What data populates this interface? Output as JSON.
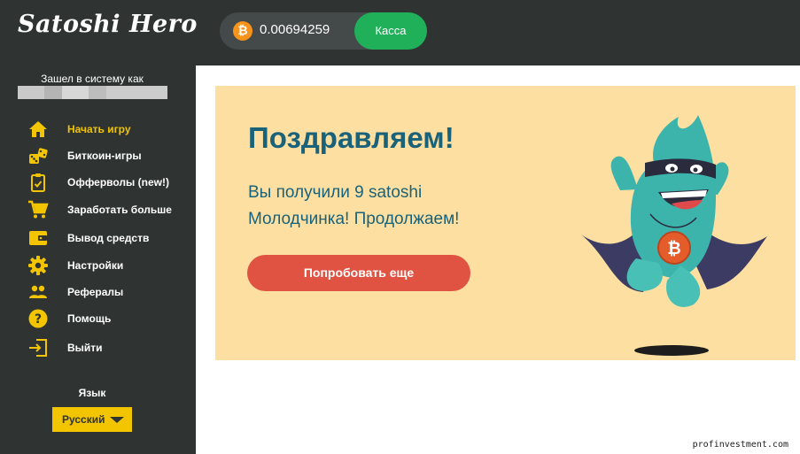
{
  "header": {
    "logo_text": "Satoshi Hero",
    "currency_icon": "bitcoin-icon",
    "currency_symbol": "₿",
    "balance": "0.00694259",
    "cashier_label": "Касса"
  },
  "sidebar": {
    "logged_in_label": "Зашел в систему как",
    "items": [
      {
        "label": "Начать игру",
        "icon": "home-icon",
        "active": true
      },
      {
        "label": "Биткоин-игры",
        "icon": "dice-icon",
        "active": false
      },
      {
        "label": "Офферволы (new!)",
        "icon": "clipboard-icon",
        "active": false
      },
      {
        "label": "Заработать больше",
        "icon": "cart-icon",
        "active": false
      },
      {
        "label": "Вывод средств",
        "icon": "wallet-icon",
        "active": false
      },
      {
        "label": "Настройки",
        "icon": "gear-icon",
        "active": false
      },
      {
        "label": "Рефералы",
        "icon": "people-icon",
        "active": false
      },
      {
        "label": "Помощь",
        "icon": "help-icon",
        "active": false
      },
      {
        "label": "Выйти",
        "icon": "logout-icon",
        "active": false
      }
    ],
    "language_title": "Язык",
    "language_selected": "Русский"
  },
  "banner": {
    "title": "Поздравляем!",
    "line1": "Вы получили 9 satoshi",
    "line2": "Молодчинка! Продолжаем!",
    "retry_label": "Попробовать еще",
    "mascot_coin_symbol": "₿"
  },
  "watermark": "profinvestment.com",
  "colors": {
    "dark": "#2f3432",
    "accent_yellow": "#f2c500",
    "green": "#21b05a",
    "banner_bg": "#fde0a1",
    "title_blue": "#19627a",
    "button_red": "#e05343",
    "bitcoin_orange": "#f7931a"
  }
}
